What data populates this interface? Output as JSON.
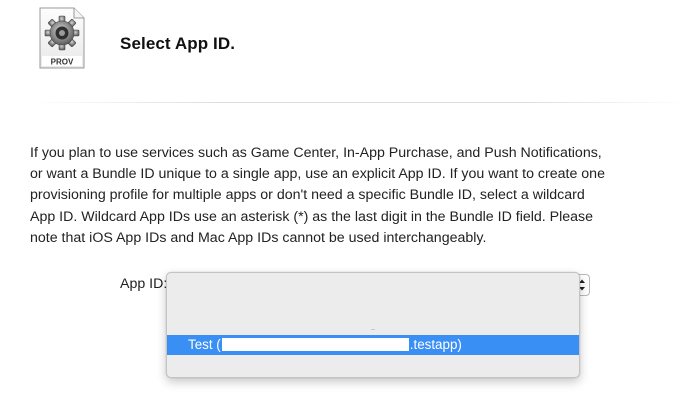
{
  "header": {
    "icon_label": "PROV",
    "title": "Select App ID."
  },
  "description": {
    "lines": [
      "If you plan to use services such as Game Center, In-App Purchase, and Push Notifications,",
      "or want a Bundle ID unique to a single app, use an explicit App ID. If you want to create one",
      "provisioning profile for multiple apps or don't need a specific Bundle ID, select a wildcard",
      "App ID. Wildcard App IDs use an asterisk (*) as the last digit in the Bundle ID field. Please",
      "note that iOS App IDs and Mac App IDs cannot be used interchangeably."
    ]
  },
  "form": {
    "app_id_label": "App ID:"
  },
  "dropdown": {
    "selected_option": {
      "prefix": "Test (",
      "suffix": ".testapp)"
    }
  },
  "colors": {
    "highlight": "#3a8ff5",
    "menu_bg": "#ececec"
  }
}
